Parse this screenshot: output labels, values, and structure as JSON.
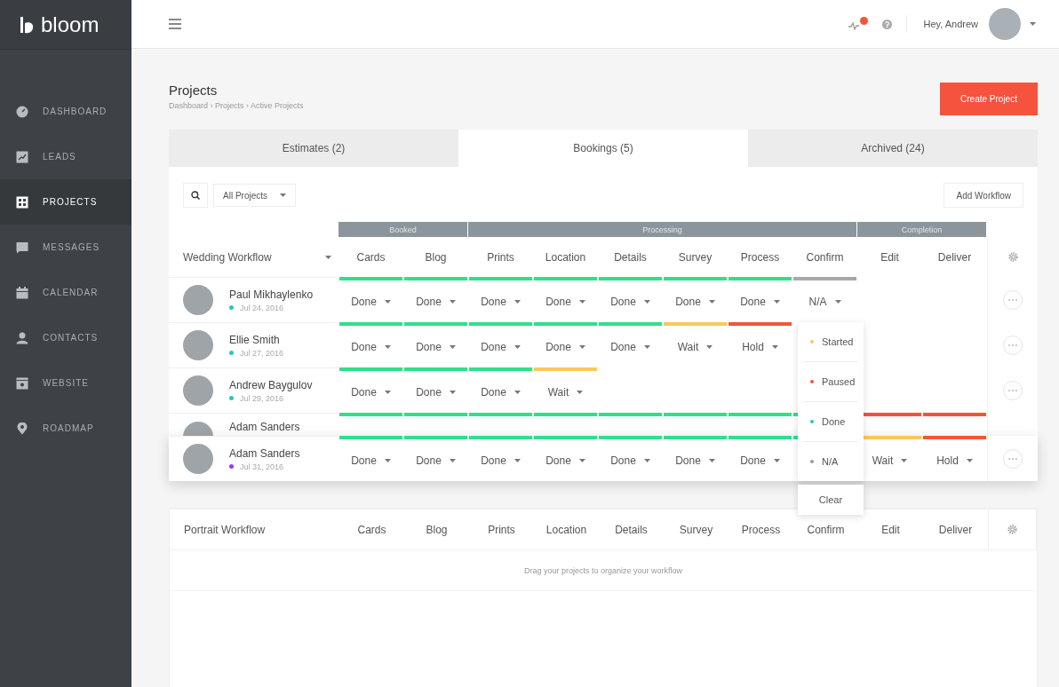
{
  "brand": {
    "name": "bloom"
  },
  "sidebar": {
    "items": [
      {
        "label": "DASHBOARD",
        "selected": false
      },
      {
        "label": "LEADS",
        "selected": false
      },
      {
        "label": "PROJECTS",
        "selected": true
      },
      {
        "label": "MESSAGES",
        "selected": false
      },
      {
        "label": "CALENDAR",
        "selected": false
      },
      {
        "label": "CONTACTS",
        "selected": false
      },
      {
        "label": "WEBSITE",
        "selected": false
      },
      {
        "label": "ROADMAP",
        "selected": false
      }
    ]
  },
  "topbar": {
    "greeting": "Hey, Andrew"
  },
  "page": {
    "title": "Projects",
    "breadcrumb": "Dashboard › Projects › Active Projects",
    "create_button": "Create Project"
  },
  "tabs": [
    {
      "label": "Estimates (2)",
      "selected": false
    },
    {
      "label": "Bookings (5)",
      "selected": true
    },
    {
      "label": "Archived (24)",
      "selected": false
    }
  ],
  "toolbar": {
    "filter": "All Projects",
    "add_button": "Add Workflow"
  },
  "workflows": [
    {
      "name": "Wedding Workflow",
      "groups": [
        {
          "label": "Booked",
          "columns": [
            "Cards",
            "Blog"
          ]
        },
        {
          "label": "Processing",
          "columns": [
            "Prints",
            "Location",
            "Details",
            "Survey",
            "Process",
            "Confirm"
          ]
        },
        {
          "label": "Completion",
          "columns": [
            "Edit",
            "Deliver"
          ]
        }
      ],
      "rows": [
        {
          "kind": "normal",
          "name": "Paul Mikhaylenko",
          "date": "Jul 24, 2016",
          "color": "#2bc5c0",
          "cells": [
            {
              "color": "#2fe089",
              "value": "Done"
            },
            {
              "color": "#2fe089",
              "value": "Done"
            },
            {
              "color": "#2fe089",
              "value": "Done"
            },
            {
              "color": "#2fe089",
              "value": "Done"
            },
            {
              "color": "#2fe089",
              "value": "Done"
            },
            {
              "color": "#2fe089",
              "value": "Done"
            },
            {
              "color": "#2fe089",
              "value": "Done"
            },
            {
              "color": "#a8a8a8",
              "value": "N/A",
              "menu": {
                "items": [
                  {
                    "label": "Started",
                    "color": "#f6c85f"
                  },
                  {
                    "label": "Paused",
                    "color": "#f2553a"
                  },
                  {
                    "label": "Done",
                    "color": "#2bc5c0"
                  },
                  {
                    "label": "N/A",
                    "color": "#9a9a9a"
                  }
                ],
                "clear": "Clear"
              }
            }
          ]
        },
        {
          "kind": "normal",
          "name": "Ellie Smith",
          "date": "Jul 27, 2016",
          "color": "#2bc5c0",
          "cells": [
            {
              "color": "#2fe089",
              "value": "Done"
            },
            {
              "color": "#2fe089",
              "value": "Done"
            },
            {
              "color": "#2fe089",
              "value": "Done"
            },
            {
              "color": "#2fe089",
              "value": "Done"
            },
            {
              "color": "#2fe089",
              "value": "Done"
            },
            {
              "color": "#f7c95c",
              "value": "Wait"
            },
            {
              "color": "#f2553a",
              "value": "Hold"
            }
          ]
        },
        {
          "kind": "normal",
          "name": "Andrew Baygulov",
          "date": "Jul 29, 2016",
          "color": "#2bc5c0",
          "cells": [
            {
              "color": "#2fe089",
              "value": "Done"
            },
            {
              "color": "#2fe089",
              "value": "Done"
            },
            {
              "color": "#2fe089",
              "value": "Done"
            },
            {
              "color": "#f7c95c",
              "value": "Wait"
            }
          ]
        },
        {
          "kind": "covered",
          "name": "Adam Sanders",
          "cells": [
            {
              "color": "#2fe089"
            },
            {
              "color": "#2fe089"
            },
            {
              "color": "#2fe089"
            },
            {
              "color": "#2fe089"
            },
            {
              "color": "#2fe089"
            },
            {
              "color": "#2fe089"
            },
            {
              "color": "#2fe089"
            },
            {
              "color": "#2fe089"
            },
            {
              "color": "#f2553a"
            },
            {
              "color": "#f2553a"
            }
          ]
        },
        {
          "kind": "dragging",
          "name": "Adam Sanders",
          "date": "Jul 31, 2016",
          "color": "#8c3cf0",
          "cells": [
            {
              "color": "#2fe089",
              "value": "Done"
            },
            {
              "color": "#2fe089",
              "value": "Done"
            },
            {
              "color": "#2fe089",
              "value": "Done"
            },
            {
              "color": "#2fe089",
              "value": "Done"
            },
            {
              "color": "#2fe089",
              "value": "Done"
            },
            {
              "color": "#2fe089",
              "value": "Done"
            },
            {
              "color": "#2fe089",
              "value": "Done"
            },
            {
              "color": "#2fe089"
            },
            {
              "color": "#f7c95c",
              "value": "Wait"
            },
            {
              "color": "#f2553a",
              "value": "Hold"
            }
          ]
        }
      ]
    },
    {
      "name": "Portrait Workflow",
      "columns": [
        "Cards",
        "Blog",
        "Prints",
        "Location",
        "Details",
        "Survey",
        "Process",
        "Confirm",
        "Edit",
        "Deliver"
      ],
      "hint": "Drag your projects to organize your workflow"
    }
  ]
}
